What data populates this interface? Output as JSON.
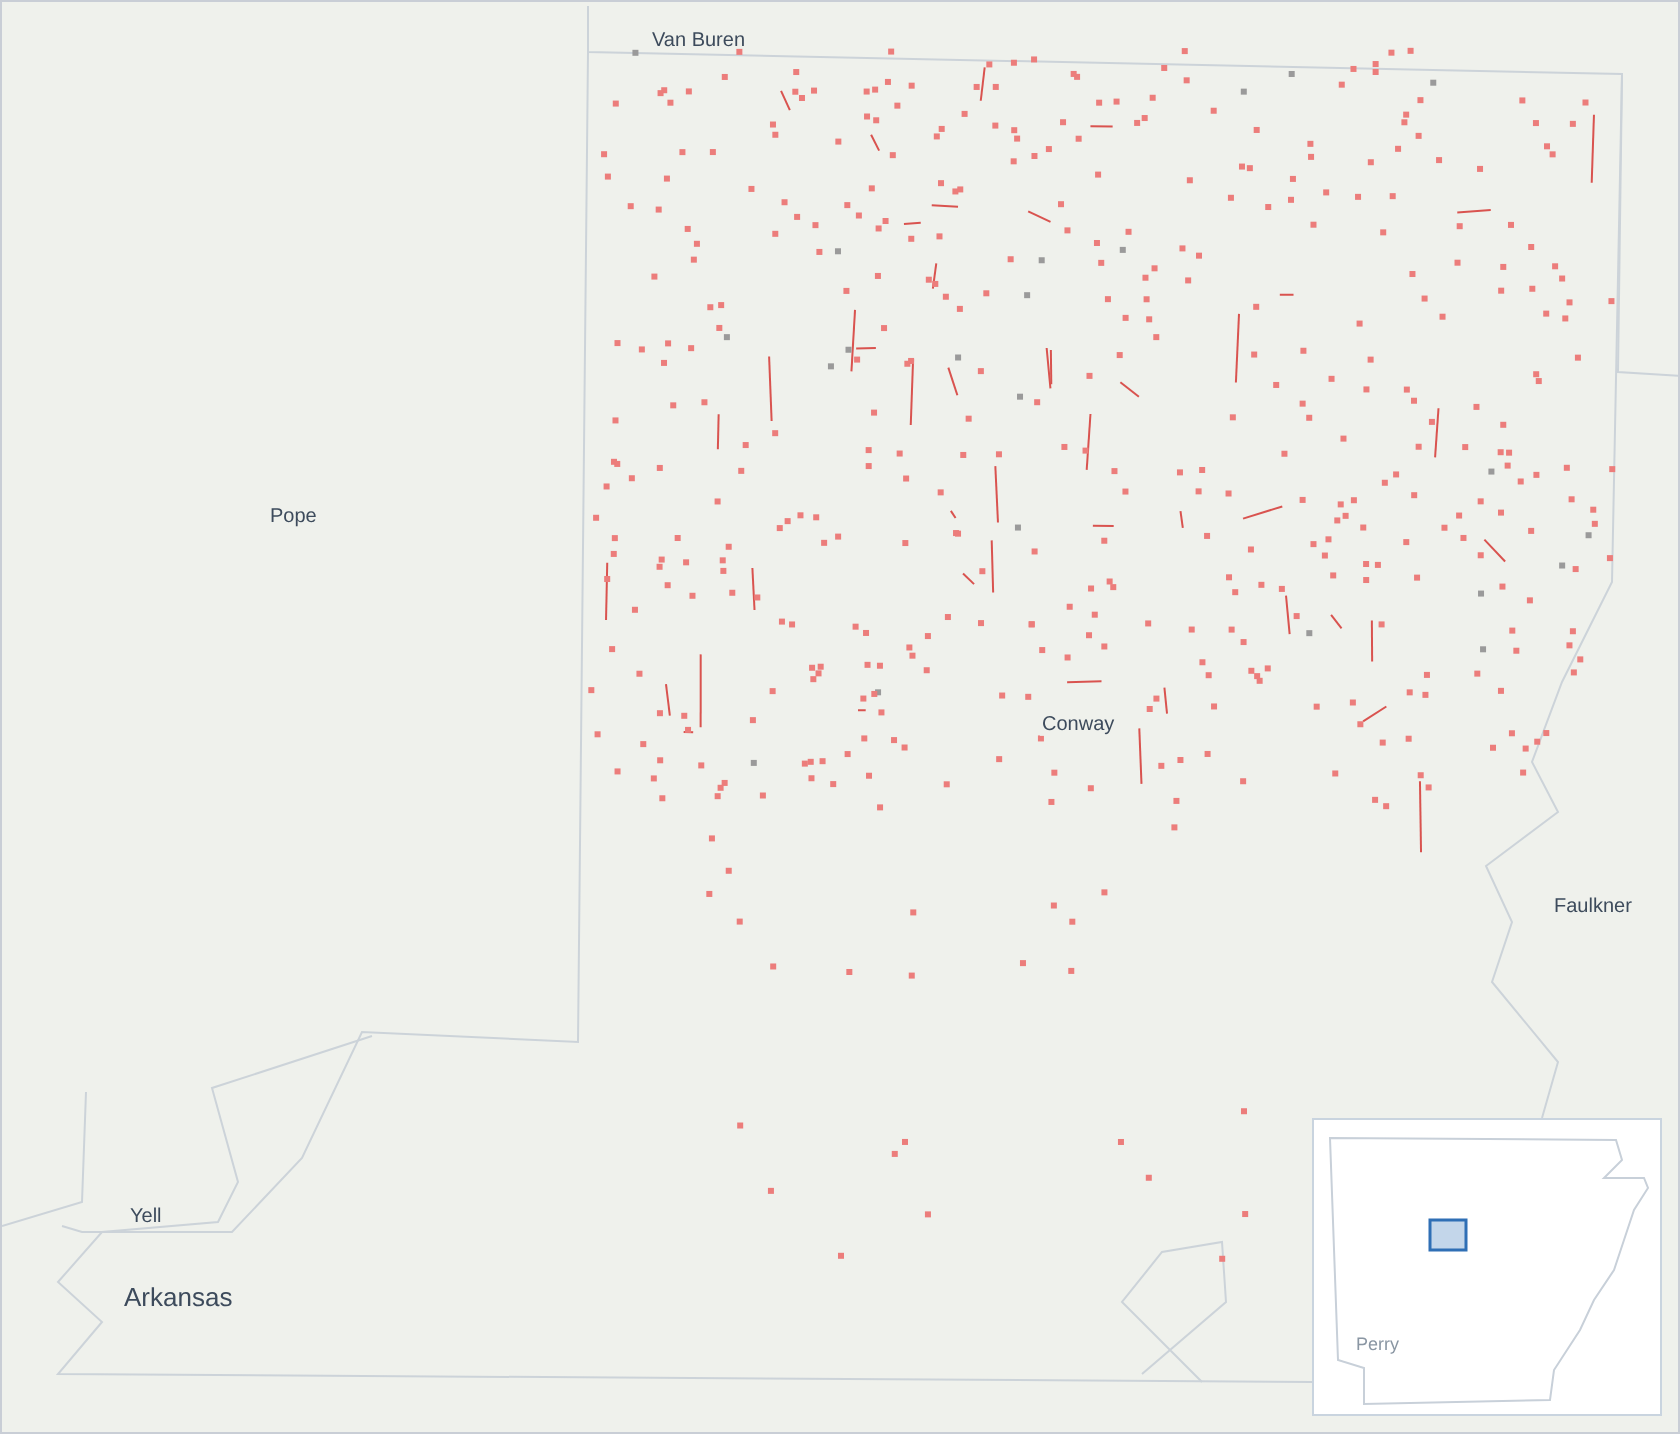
{
  "map": {
    "labels": [
      {
        "text": "Van Buren",
        "kind": "county"
      },
      {
        "text": "Pope",
        "kind": "county"
      },
      {
        "text": "Conway",
        "kind": "city"
      },
      {
        "text": "Faulkner",
        "kind": "county"
      },
      {
        "text": "Yell",
        "kind": "county"
      },
      {
        "text": "Arkansas",
        "kind": "state"
      }
    ]
  },
  "inset": {
    "labels": [
      {
        "text": "Perry",
        "kind": "faint"
      }
    ]
  }
}
